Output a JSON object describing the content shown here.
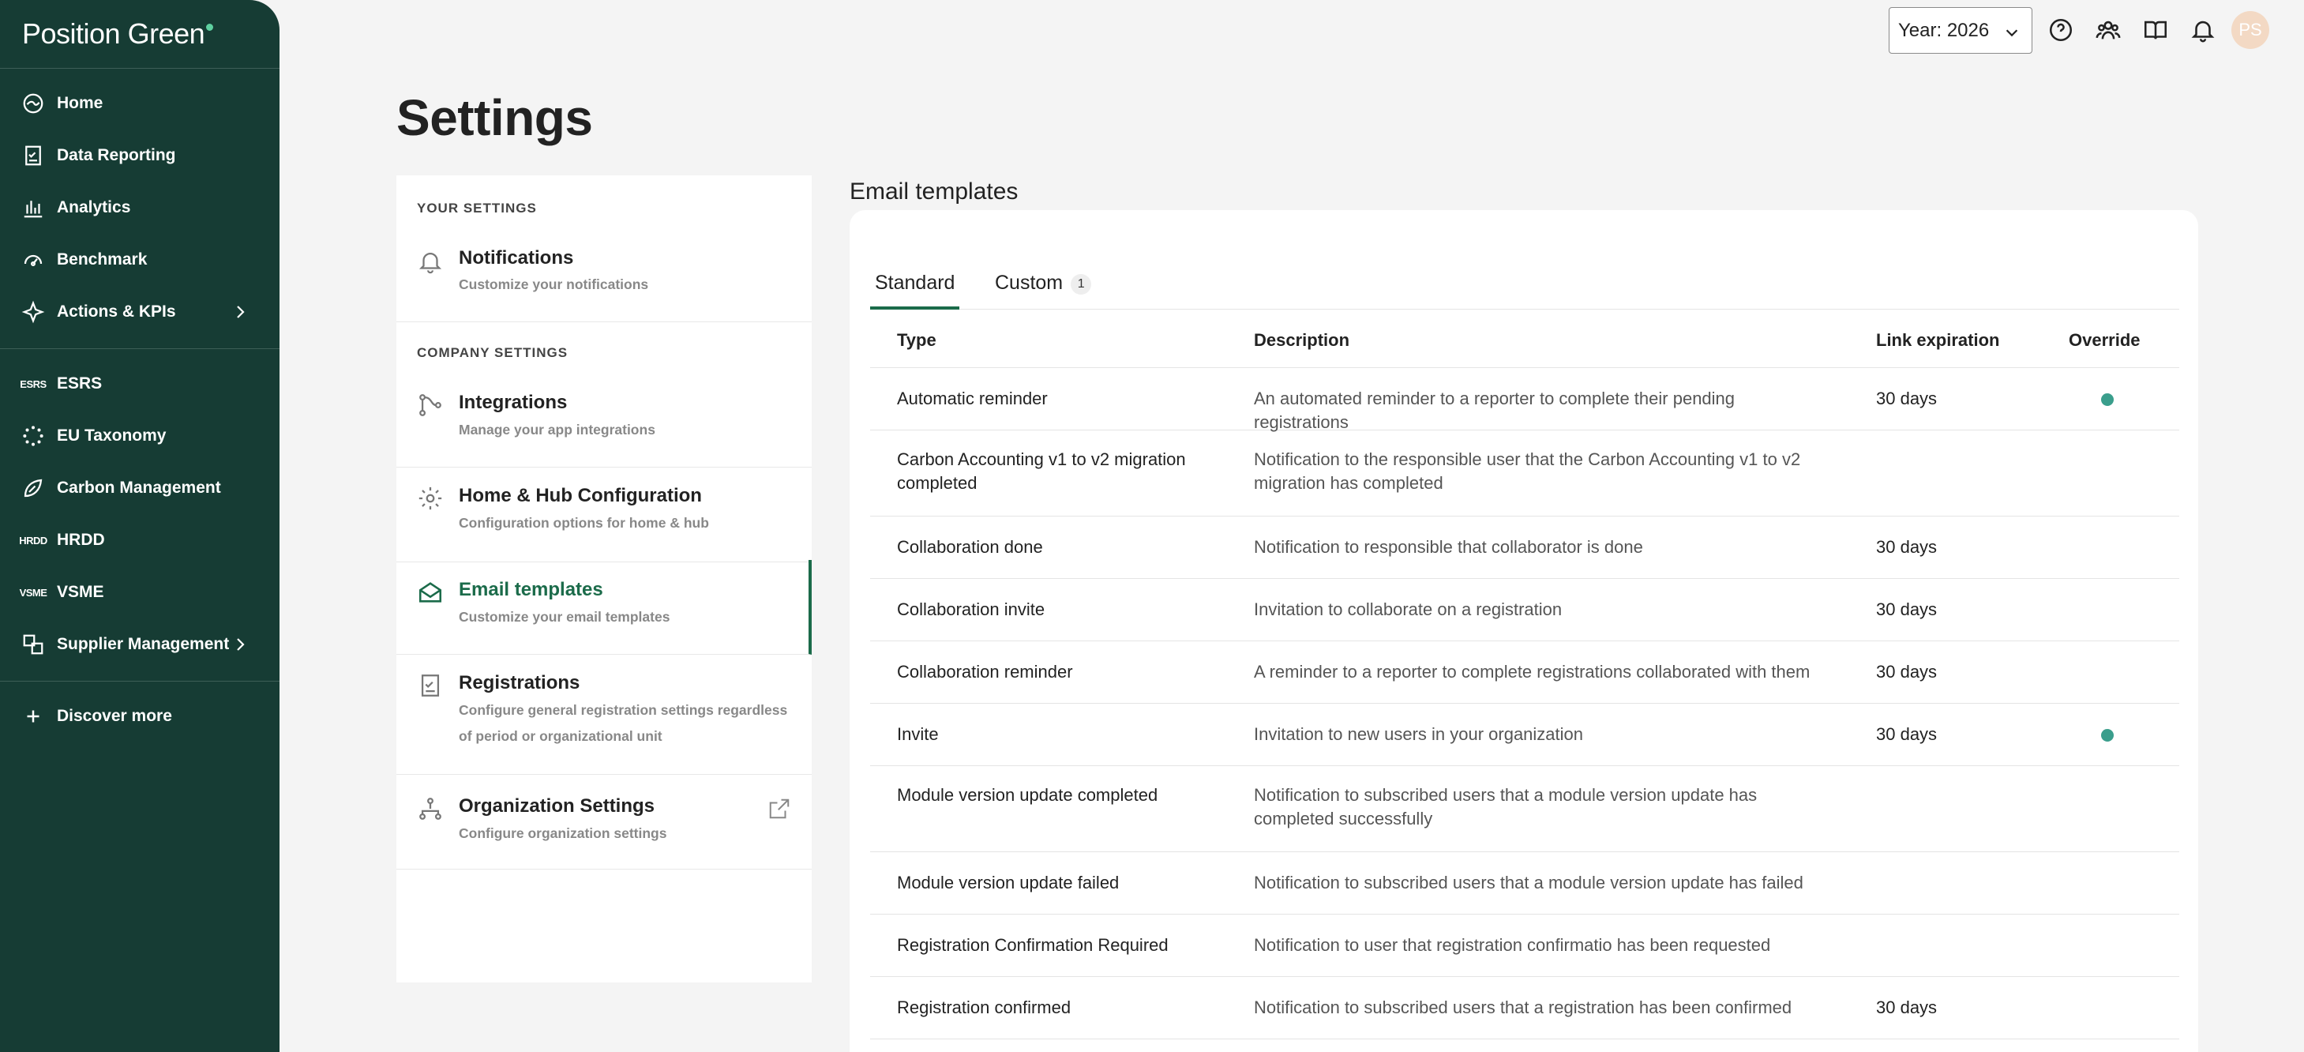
{
  "app": {
    "logo_text": "Position Green",
    "accent_color": "#1b6b4a",
    "sidebar_color": "#163c34"
  },
  "sidebar": {
    "items": [
      {
        "label": "Home",
        "icon": "home-icon"
      },
      {
        "label": "Data Reporting",
        "icon": "data-reporting-icon"
      },
      {
        "label": "Analytics",
        "icon": "analytics-icon"
      },
      {
        "label": "Benchmark",
        "icon": "benchmark-icon"
      },
      {
        "label": "Actions & KPIs",
        "icon": "actions-icon"
      },
      {
        "label": "ESRS",
        "icon_text": "ESRS"
      },
      {
        "label": "EU Taxonomy",
        "icon": "eu-taxonomy-icon"
      },
      {
        "label": "Carbon Management",
        "icon": "carbon-icon"
      },
      {
        "label": "HRDD",
        "icon_text": "HRDD"
      },
      {
        "label": "VSME",
        "icon_text": "VSME"
      },
      {
        "label": "Supplier Management",
        "icon": "supplier-icon"
      },
      {
        "label": "Discover more",
        "icon": "plus-icon"
      }
    ]
  },
  "topbar": {
    "year_label": "Year: 2026",
    "avatar_initials": "PS"
  },
  "page": {
    "title": "Settings"
  },
  "settings": {
    "your_settings_label": "YOUR SETTINGS",
    "company_settings_label": "COMPANY SETTINGS",
    "items": [
      {
        "title": "Notifications",
        "desc": "Customize your notifications"
      },
      {
        "title": "Integrations",
        "desc": "Manage your app integrations"
      },
      {
        "title": "Home & Hub Configuration",
        "desc": "Configuration options for home & hub"
      },
      {
        "title": "Email templates",
        "desc": "Customize your email templates"
      },
      {
        "title": "Registrations",
        "desc": "Configure general registration settings regardless of period or organizational unit"
      },
      {
        "title": "Organization Settings",
        "desc": "Configure organization settings"
      }
    ]
  },
  "email_templates": {
    "title": "Email templates",
    "tabs": [
      {
        "label": "Standard"
      },
      {
        "label": "Custom",
        "badge": "1"
      }
    ],
    "columns": {
      "type": "Type",
      "description": "Description",
      "link_expiration": "Link expiration",
      "override": "Override"
    },
    "rows": [
      {
        "type": "Automatic reminder",
        "description": "An automated reminder to a reporter to complete their pending registrations",
        "expiration": "30 days",
        "override": true
      },
      {
        "type": "Carbon Accounting v1 to v2 migration completed",
        "description": "Notification to the responsible user that the Carbon Accounting v1 to v2 migration has completed",
        "expiration": "",
        "override": false
      },
      {
        "type": "Collaboration done",
        "description": "Notification to responsible that collaborator is done",
        "expiration": "30 days",
        "override": false
      },
      {
        "type": "Collaboration invite",
        "description": "Invitation to collaborate on a registration",
        "expiration": "30 days",
        "override": false
      },
      {
        "type": "Collaboration reminder",
        "description": "A reminder to a reporter to complete registrations collaborated with them",
        "expiration": "30 days",
        "override": false
      },
      {
        "type": "Invite",
        "description": "Invitation to new users in your organization",
        "expiration": "30 days",
        "override": true
      },
      {
        "type": "Module version update completed",
        "description": "Notification to subscribed users that a module version update has completed successfully",
        "expiration": "",
        "override": false
      },
      {
        "type": "Module version update failed",
        "description": "Notification to subscribed users that a module version update has failed",
        "expiration": "",
        "override": false
      },
      {
        "type": "Registration Confirmation Required",
        "description": "Notification to user that registration confirmatio has been requested",
        "expiration": "",
        "override": false
      },
      {
        "type": "Registration confirmed",
        "description": "Notification to subscribed users that a registration has been confirmed",
        "expiration": "30 days",
        "override": false
      }
    ]
  }
}
